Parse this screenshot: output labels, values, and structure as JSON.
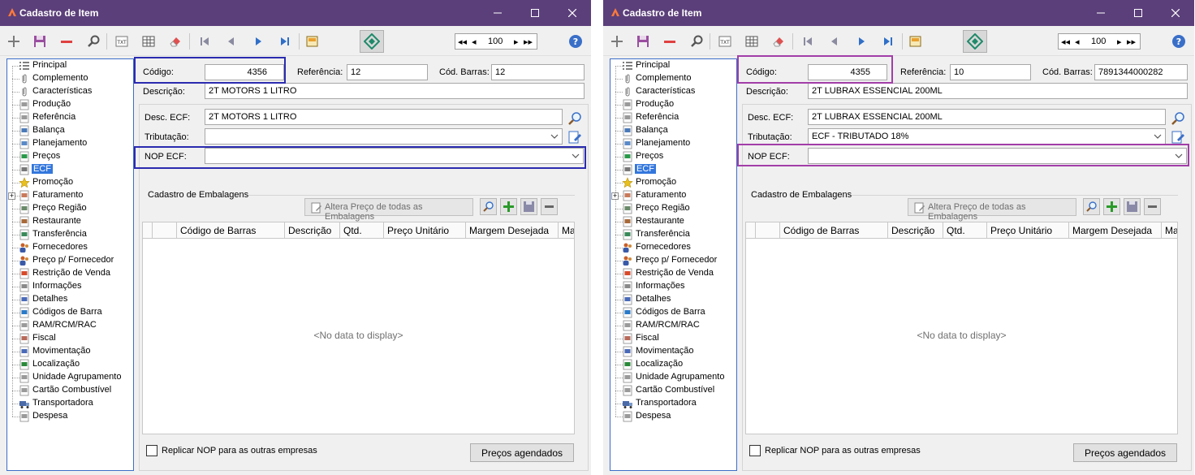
{
  "common": {
    "window_title": "Cadastro de Item",
    "nav_value": "100",
    "nav_first": "◂◂",
    "nav_prev": "◂",
    "nav_next": "▸",
    "nav_last": "▸▸",
    "labels": {
      "codigo": "Código:",
      "referencia": "Referência:",
      "cod_barras": "Cód. Barras:",
      "descricao": "Descrição:",
      "desc_ecf": "Desc. ECF:",
      "tributacao": "Tributação:",
      "nop_ecf": "NOP ECF:",
      "cadastro_embalagens": "Cadastro de Embalagens",
      "altera_preco": "Altera Preço de todas as Embalagens",
      "replicar_nop": "Replicar NOP para as outras empresas",
      "precos_agendados": "Preços agendados",
      "no_data": "<No data to display>"
    },
    "grid_columns": [
      "",
      "Código de Barras",
      "Descrição",
      "Qtd.",
      "Preço Unitário",
      "Margem Desejada",
      "Ma"
    ],
    "tree": [
      {
        "label": "Principal",
        "icon": "list-icon"
      },
      {
        "label": "Complemento",
        "icon": "paperclip-icon"
      },
      {
        "label": "Características",
        "icon": "paperclip-icon"
      },
      {
        "label": "Produção",
        "icon": "document-icon"
      },
      {
        "label": "Referência",
        "icon": "document-icon"
      },
      {
        "label": "Balança",
        "icon": "scale-icon"
      },
      {
        "label": "Planejamento",
        "icon": "calendar-icon"
      },
      {
        "label": "Preços",
        "icon": "money-icon"
      },
      {
        "label": "ECF",
        "icon": "printer-icon"
      },
      {
        "label": "Promoção",
        "icon": "star-icon"
      },
      {
        "label": "Faturamento",
        "icon": "invoice-icon"
      },
      {
        "label": "Preço Região",
        "icon": "region-icon"
      },
      {
        "label": "Restaurante",
        "icon": "restaurant-icon"
      },
      {
        "label": "Transferência",
        "icon": "transfer-icon"
      },
      {
        "label": "Fornecedores",
        "icon": "people-icon"
      },
      {
        "label": "Preço p/ Fornecedor",
        "icon": "people-icon"
      },
      {
        "label": "Restrição de Venda",
        "icon": "restriction-icon"
      },
      {
        "label": "Informações",
        "icon": "info-doc-icon"
      },
      {
        "label": "Detalhes",
        "icon": "pencil-doc-icon"
      },
      {
        "label": "Códigos de Barra",
        "icon": "shapes-icon"
      },
      {
        "label": "RAM/RCM/RAC",
        "icon": "document-icon"
      },
      {
        "label": "Fiscal",
        "icon": "fiscal-icon"
      },
      {
        "label": "Movimentação",
        "icon": "magnifier-doc-icon"
      },
      {
        "label": "Localização",
        "icon": "location-icon"
      },
      {
        "label": "Unidade Agrupamento",
        "icon": "document-icon"
      },
      {
        "label": "Cartão Combustível",
        "icon": "document-icon"
      },
      {
        "label": "Transportadora",
        "icon": "truck-icon"
      },
      {
        "label": "Despesa",
        "icon": "document-icon"
      }
    ],
    "selected_tree_item": "ECF"
  },
  "windows": [
    {
      "codigo": "4356",
      "referencia": "12",
      "cod_barras": "12",
      "descricao": "2T MOTORS 1 LITRO",
      "desc_ecf": "2T MOTORS 1 LITRO",
      "tributacao": "",
      "nop_ecf": "",
      "highlight_color": "#2b2bb0"
    },
    {
      "codigo": "4355",
      "referencia": "10",
      "cod_barras": "7891344000282",
      "descricao": "2T LUBRAX ESSENCIAL 200ML",
      "desc_ecf": "2T LUBRAX ESSENCIAL 200ML",
      "tributacao": "ECF - TRIBUTADO 18%",
      "nop_ecf": "",
      "highlight_color": "#a23ea8"
    }
  ],
  "colors": {
    "titlebar": "#5b3f7a",
    "tree_border": "#3c6ec8",
    "selection": "#3377dd"
  }
}
